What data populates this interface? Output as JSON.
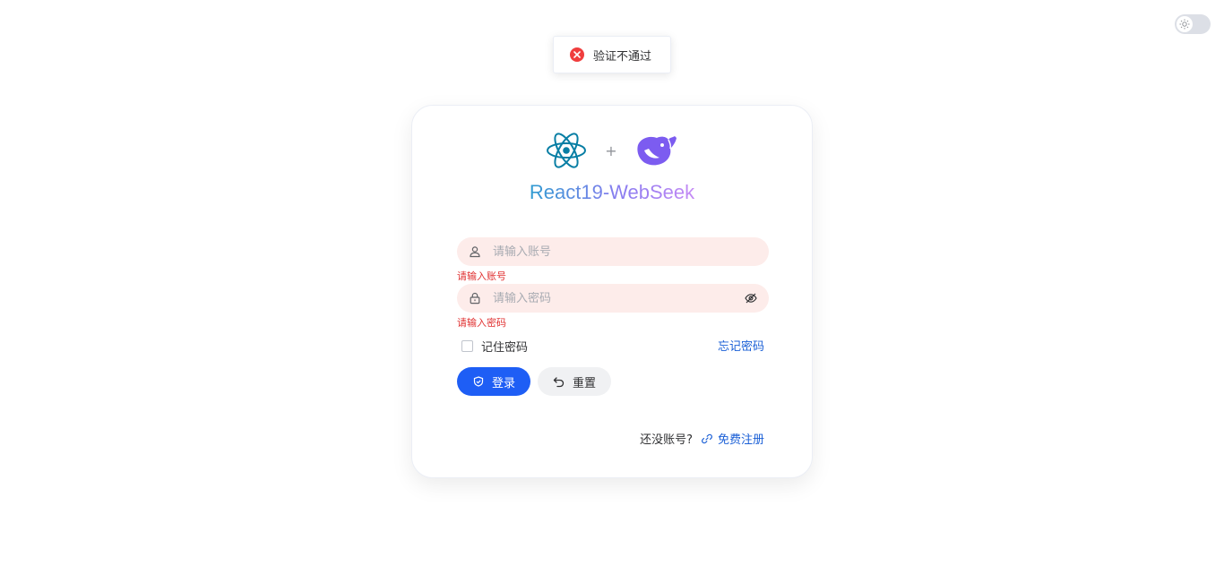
{
  "toast": {
    "message": "验证不通过",
    "icon": "error-circle-icon",
    "color": "#f03e3e"
  },
  "theme_toggle": {
    "icon": "sun-icon"
  },
  "header": {
    "logo_left": "react-logo-icon",
    "plus": "+",
    "logo_right": "deepseek-whale-icon",
    "title": "React19-WebSeek"
  },
  "form": {
    "username": {
      "placeholder": "请输入账号",
      "value": "",
      "icon": "user-icon",
      "error": "请输入账号"
    },
    "password": {
      "placeholder": "请输入密码",
      "value": "",
      "icon": "lock-icon",
      "toggle_icon": "eye-off-icon",
      "error": "请输入密码"
    },
    "remember_label": "记住密码",
    "forgot_label": "忘记密码",
    "login_label": "登录",
    "reset_label": "重置",
    "no_account_text": "还没账号?",
    "register_label": "免费注册"
  },
  "colors": {
    "primary": "#1e5ef5",
    "error": "#e03131",
    "link": "#1a5fd6",
    "field_error_bg": "#fdecea"
  }
}
